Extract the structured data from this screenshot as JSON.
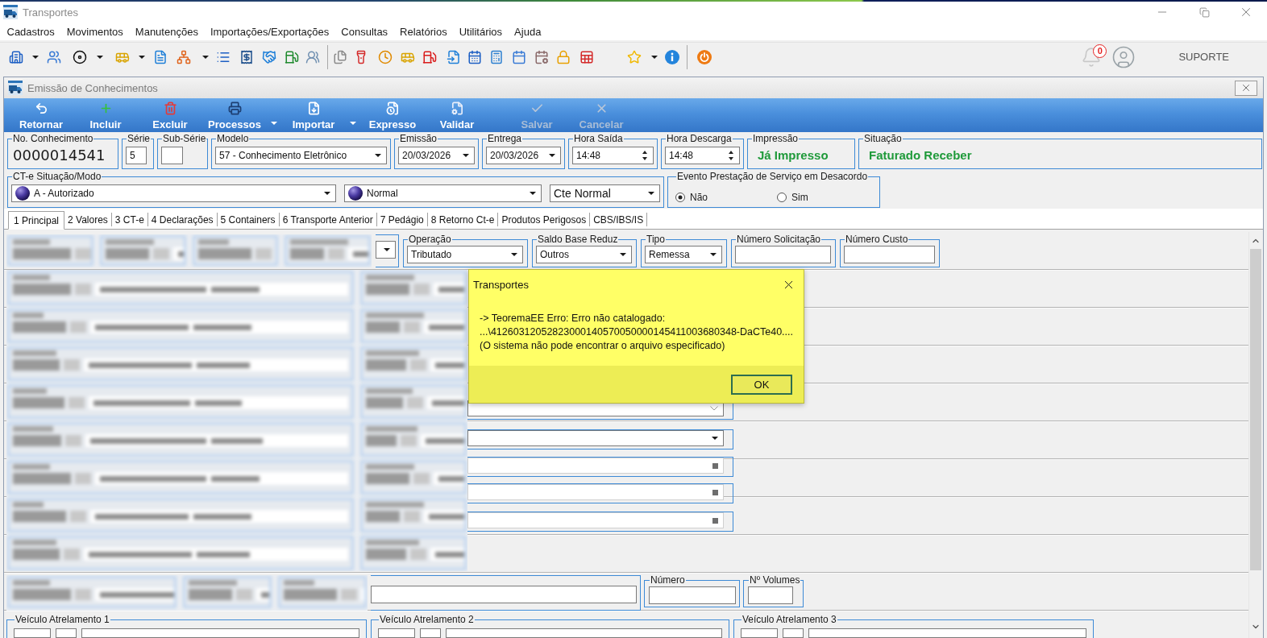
{
  "window": {
    "title": "Transportes",
    "menu": [
      "Cadastros",
      "Movimentos",
      "Manutenções",
      "Importações/Exportações",
      "Consultas",
      "Relatórios",
      "Utilitários",
      "Ajuda"
    ],
    "notifications": "0",
    "user": "SUPORTE"
  },
  "document_window": {
    "title": "Emissão de Conhecimentos",
    "actions": [
      {
        "label": "Retornar",
        "disabled": false,
        "has_menu": false
      },
      {
        "label": "Incluir",
        "disabled": false,
        "has_menu": false
      },
      {
        "label": "Excluir",
        "disabled": false,
        "has_menu": false
      },
      {
        "label": "Processos",
        "disabled": false,
        "has_menu": true
      },
      {
        "label": "Importar",
        "disabled": false,
        "has_menu": true
      },
      {
        "label": "Expresso",
        "disabled": false,
        "has_menu": false
      },
      {
        "label": "Validar",
        "disabled": false,
        "has_menu": false
      },
      {
        "label": "Salvar",
        "disabled": true,
        "has_menu": false
      },
      {
        "label": "Cancelar",
        "disabled": true,
        "has_menu": false
      }
    ]
  },
  "header": [
    {
      "kind": "display",
      "label": "No. Conhecimento",
      "value": "0000014541"
    },
    {
      "kind": "input",
      "label": "Série",
      "value": "5"
    },
    {
      "kind": "input",
      "label": "Sub-Série"
    },
    {
      "kind": "select",
      "label": "Modelo",
      "value": "57 - Conhecimento Eletrônico"
    },
    {
      "kind": "select",
      "label": "Emissão",
      "value": "20/03/2026"
    },
    {
      "kind": "select",
      "label": "Entrega",
      "value": "20/03/2026"
    },
    {
      "kind": "spin",
      "label": "Hora Saída",
      "value": "14:48"
    },
    {
      "kind": "spin",
      "label": "Hora Descarga",
      "value": "14:48"
    },
    {
      "kind": "status",
      "label": "Impressão",
      "value": "Já Impresso"
    },
    {
      "kind": "status",
      "label": "Situação",
      "value": "Faturado Receber"
    }
  ],
  "cte": {
    "label": "CT-e Situação/Modo",
    "selects": [
      {
        "kind": "icon_select",
        "value": "A - Autorizado"
      },
      {
        "kind": "icon_select",
        "value": "Normal"
      },
      {
        "kind": "select",
        "value": "Cte Normal"
      }
    ]
  },
  "disagreement_event": {
    "label": "Evento Prestação de Serviço em Desacordo",
    "options": [
      {
        "label": "Não",
        "selected": true
      },
      {
        "label": "Sim",
        "selected": false
      }
    ]
  },
  "tabs": [
    {
      "label": "1 Principal",
      "selected": true
    },
    {
      "label": "2 Valores",
      "selected": false
    },
    {
      "label": "3 CT-e",
      "selected": false
    },
    {
      "label": "4 Declarações",
      "selected": false
    },
    {
      "label": "5 Containers",
      "selected": false
    },
    {
      "label": "6 Transporte Anterior",
      "selected": false
    },
    {
      "label": "7 Pedágio",
      "selected": false
    },
    {
      "label": "8 Retorno Ct-e",
      "selected": false
    },
    {
      "label": "Produtos Perigosos",
      "selected": false
    },
    {
      "label": "CBS/IBS/IS",
      "selected": false
    }
  ],
  "principal_tab": {
    "row_1": [
      {
        "kind": "select"
      },
      {
        "kind": "select",
        "label": "Operação",
        "value": "Tributado"
      },
      {
        "kind": "select",
        "label": "Saldo Base Reduz",
        "value": "Outros"
      },
      {
        "kind": "select",
        "label": "Tipo",
        "value": "Remessa"
      },
      {
        "kind": "input",
        "label": "Número Solicitação"
      },
      {
        "kind": "input",
        "label": "Número Custo"
      }
    ],
    "partial_fields": [
      {
        "kind": "select",
        "disabled": true
      },
      {
        "kind": "select",
        "disabled": false
      },
      {
        "kind": "lookup"
      },
      {
        "kind": "lookup"
      },
      {
        "kind": "lookup"
      }
    ],
    "row_volumes": [
      {
        "kind": "input"
      },
      {
        "kind": "input",
        "label": "Número"
      },
      {
        "kind": "input",
        "label": "Nº Volumes"
      }
    ],
    "trailers": [
      {
        "label": "Veículo Atrelamento 1"
      },
      {
        "label": "Veículo Atrelamento 2"
      },
      {
        "label": "Veículo Atrelamento 3"
      }
    ]
  },
  "dialog": {
    "title": "Transportes",
    "message": "-> TeoremaEE Erro: Erro não catalogado:\n...\\41260312052823000140570050000145411003680348-DaCTe40....\n(O sistema não pode encontrar o arquivo especificado)",
    "button": "OK"
  }
}
